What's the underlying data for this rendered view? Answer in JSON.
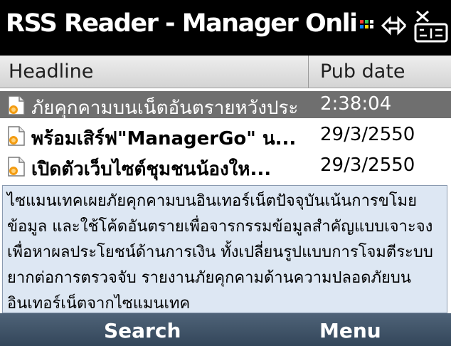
{
  "window": {
    "title": "RSS Reader - Manager Online - Cyb",
    "status_icons": [
      "signal-icon",
      "connection-icon",
      "close-icon"
    ]
  },
  "columns": {
    "headline": "Headline",
    "pub_date": "Pub date"
  },
  "items": [
    {
      "headline": "ภัยคุกคามบนเน็ตอันตรายหวังประ",
      "pub_date": "2:38:04",
      "selected": true,
      "unread": false,
      "icon": "rss-document-icon"
    },
    {
      "headline": "พร้อมเสิร์ฟ\"ManagerGo\" น...",
      "pub_date": "29/3/2550",
      "selected": false,
      "unread": true,
      "icon": "rss-document-icon"
    },
    {
      "headline": "เปิดตัวเว็บไซต์ชุมชนน้องให...",
      "pub_date": "29/3/2550",
      "selected": false,
      "unread": true,
      "icon": "rss-document-icon"
    }
  ],
  "preview": {
    "text": "ไซแมนเทคเผยภัยคุกคามบนอินเทอร์เน็ตปัจจุบันเน้นการขโมยข้อมูล และใช้โค้ดอันตรายเพื่อจารกรรมข้อมูลสำคัญแบบเจาะจง เพื่อหาผลประโยชน์ด้านการเงิน ทั้งเปลี่ยนรูปแบบการโจมตีระบบยากต่อการตรวจจับ รายงานภัยคุกคามด้านความปลอดภัยบนอินเทอร์เน็ตจากไซแมนเทค"
  },
  "softkeys": {
    "left": "Search",
    "right": "Menu"
  },
  "colors": {
    "title_bg": "#000000",
    "selected_row": "#6f6f6f",
    "preview_bg": "#dde7f3",
    "softkey_bg": "#3f5267",
    "rss_orange": "#f39c12"
  }
}
